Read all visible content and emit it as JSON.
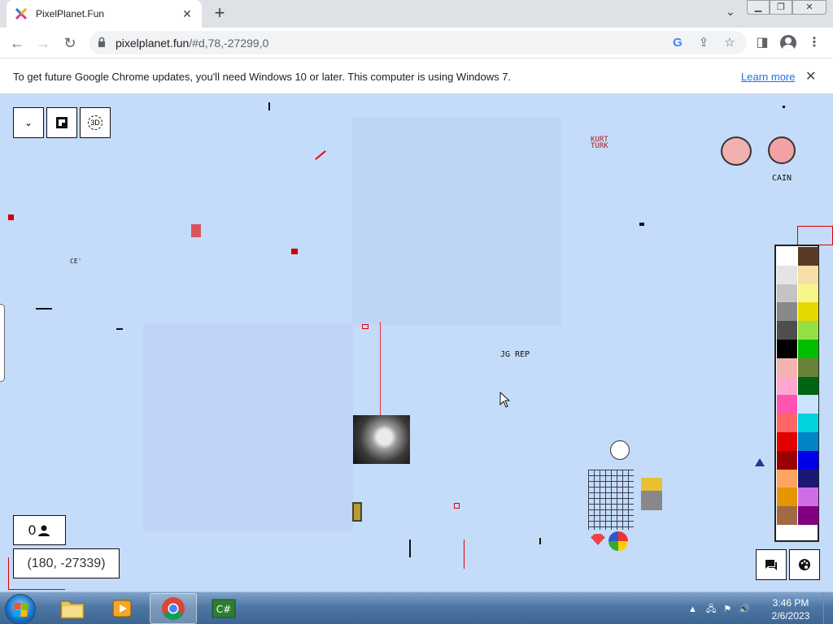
{
  "browser": {
    "tab_title": "PixelPlanet.Fun",
    "url_host": "pixelplanet.fun",
    "url_path": "/#d,78,-27299,0"
  },
  "infobar": {
    "message": "To get future Google Chrome updates, you'll need Windows 10 or later. This computer is using Windows 7.",
    "link": "Learn more"
  },
  "canvas": {
    "online_count": "0",
    "coordinates": "(180, -27339)",
    "art_labels": {
      "kurt": "KURT",
      "turk": "TURK",
      "cain": "CAIN",
      "jg_rep": "JG REP",
      "ce": "CE'"
    }
  },
  "palette": {
    "colors": [
      "#ffffff",
      "#5a3a24",
      "#e4e4e4",
      "#f5dfa6",
      "#c4c4c4",
      "#f8f58a",
      "#888888",
      "#e5d900",
      "#4e4e4e",
      "#94e044",
      "#000000",
      "#02be01",
      "#f4b3ae",
      "#688338",
      "#ffa7d1",
      "#006513",
      "#ff54b2",
      "#cae3ff",
      "#ff6565",
      "#00d3dd",
      "#e50000",
      "#0083c7",
      "#9a0000",
      "#0000ea",
      "#fea460",
      "#191973",
      "#e59500",
      "#cf6ee4",
      "#a06a42",
      "#820080"
    ]
  },
  "taskbar": {
    "time": "3:46 PM",
    "date": "2/6/2023"
  }
}
